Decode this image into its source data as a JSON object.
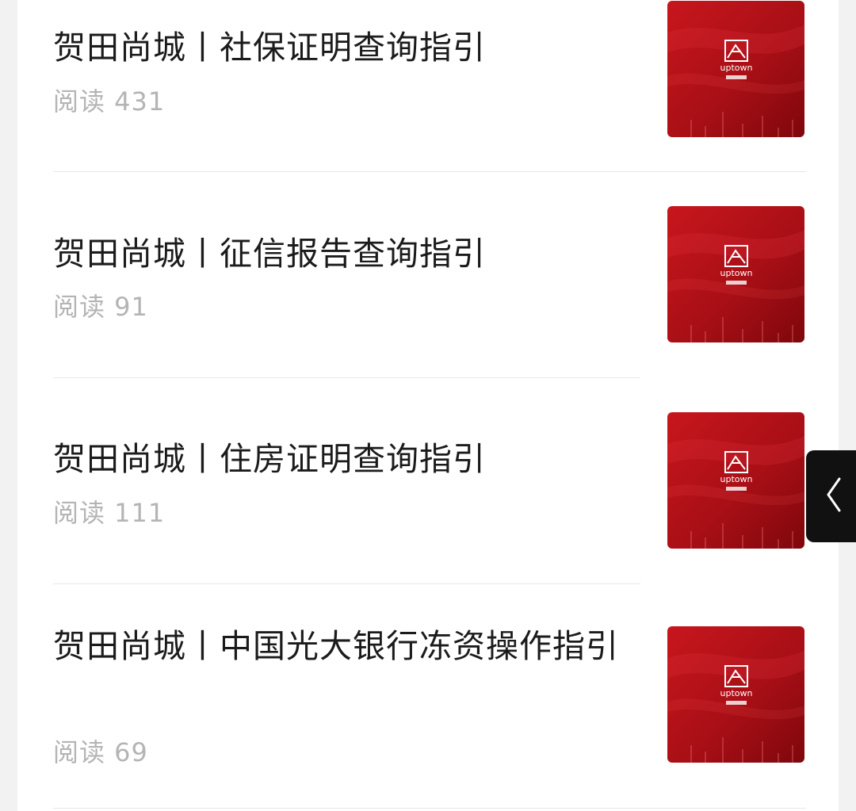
{
  "articles": [
    {
      "title": "贺田尚城丨社保证明查询指引",
      "reads": "阅读 431"
    },
    {
      "title": "贺田尚城丨征信报告查询指引",
      "reads": "阅读 91"
    },
    {
      "title": "贺田尚城丨住房证明查询指引",
      "reads": "阅读 111"
    },
    {
      "title": "贺田尚城丨中国光大银行冻资操作指引",
      "reads": "阅读 69"
    }
  ],
  "thumbnail": {
    "brand_text": "uptown",
    "colors": {
      "dark": "#8e0a10",
      "mid": "#b8141b",
      "light": "#d8242c"
    }
  },
  "side_tab": {
    "icon": "chevron-left-icon"
  }
}
